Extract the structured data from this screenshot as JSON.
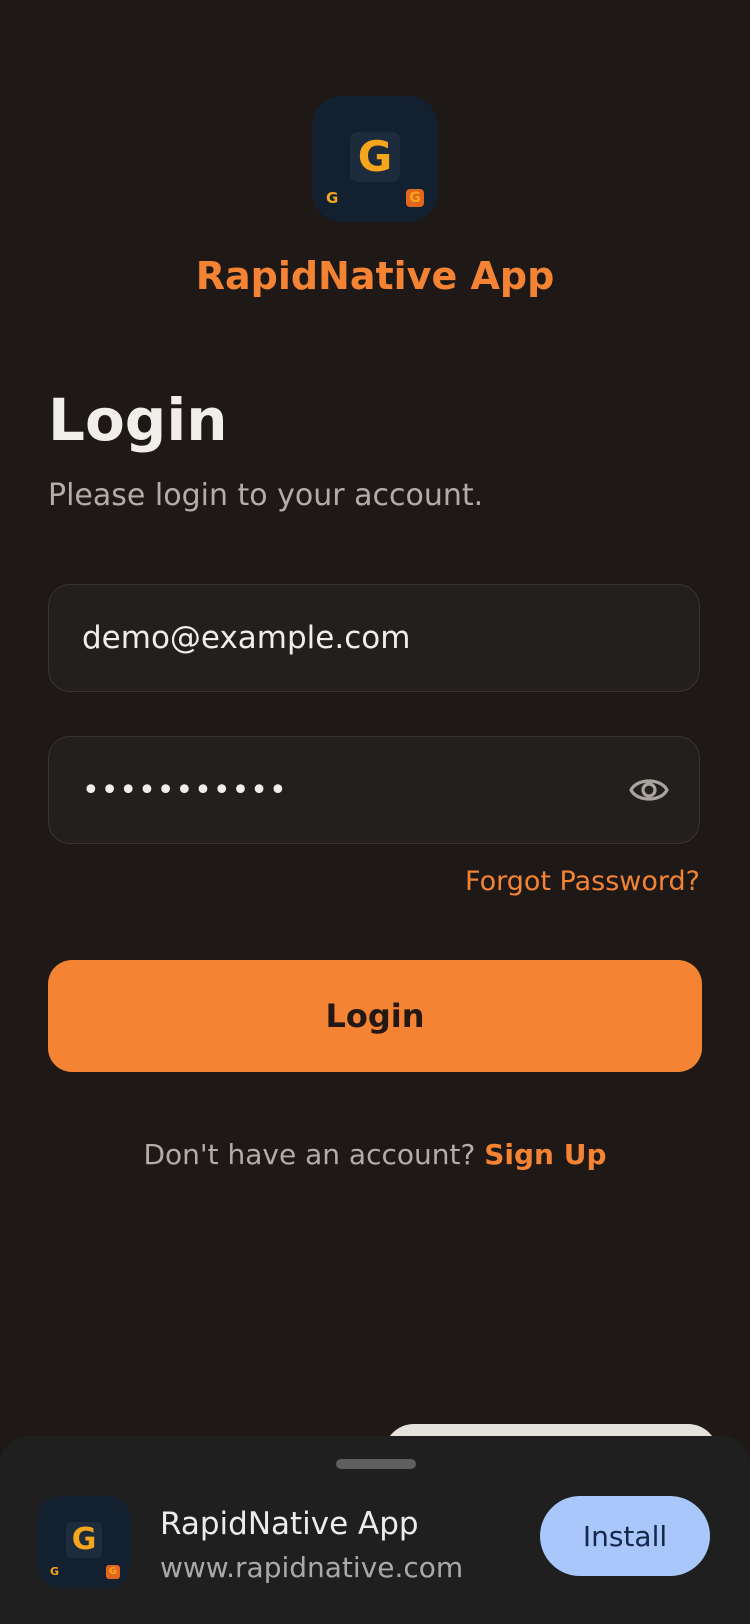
{
  "app": {
    "name": "RapidNative App",
    "icon_letter": "G",
    "icon_small_letter": "G",
    "icon_badge_letter": "G"
  },
  "login": {
    "title": "Login",
    "subtitle": "Please login to your account.",
    "email_value": "demo@example.com",
    "password_mask": "•••••••••••",
    "forgot_password": "Forgot Password?",
    "login_button": "Login",
    "no_account_text": "Don't have an account? ",
    "signup_link": "Sign Up"
  },
  "install_sheet": {
    "app_name": "RapidNative App",
    "url": "www.rapidnative.com",
    "install_button": "Install"
  },
  "colors": {
    "background": "#1e1917",
    "accent": "#f48434",
    "install_button": "#a9c7fa"
  },
  "icons": {
    "password_toggle": "eye-icon",
    "app_logo": "app-logo-icon"
  }
}
